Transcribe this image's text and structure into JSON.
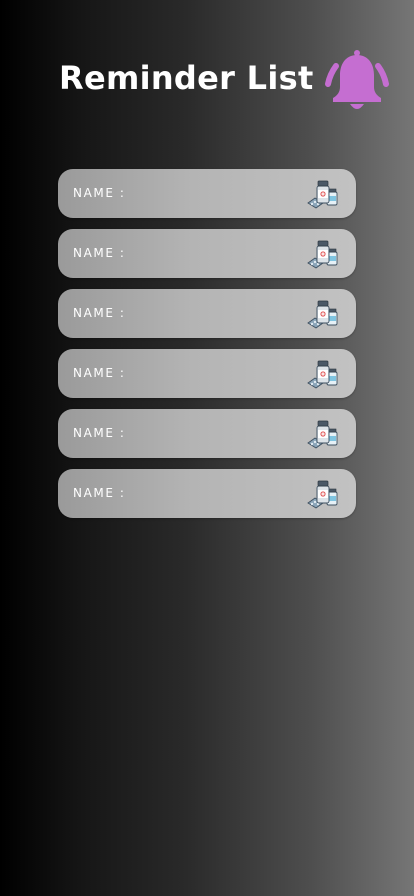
{
  "header": {
    "title": "Reminder List",
    "icon": "bell-icon",
    "icon_color": "#c56ed1"
  },
  "reminders": [
    {
      "label": "NAME :",
      "value": "",
      "icon": "medicine-icon"
    },
    {
      "label": "NAME :",
      "value": "",
      "icon": "medicine-icon"
    },
    {
      "label": "NAME :",
      "value": "",
      "icon": "medicine-icon"
    },
    {
      "label": "NAME :",
      "value": "",
      "icon": "medicine-icon"
    },
    {
      "label": "NAME :",
      "value": "",
      "icon": "medicine-icon"
    },
    {
      "label": "NAME :",
      "value": "",
      "icon": "medicine-icon"
    }
  ]
}
